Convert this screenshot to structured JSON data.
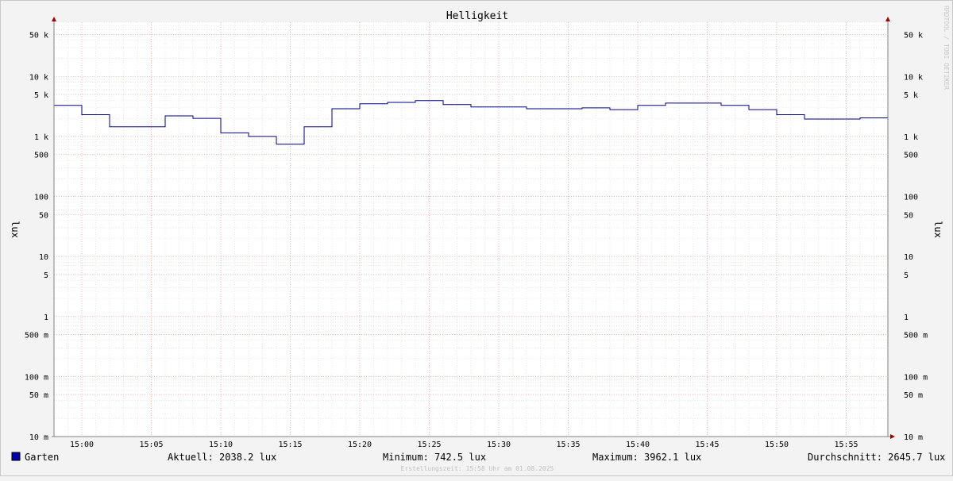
{
  "chart_data": {
    "type": "line",
    "title": "Helligkeit",
    "ylabel": "lux",
    "yscale": "log",
    "ylim": [
      0.01,
      80000
    ],
    "y_ticks": [
      {
        "v": 50000,
        "label": "50 k"
      },
      {
        "v": 10000,
        "label": "10 k"
      },
      {
        "v": 5000,
        "label": "5 k"
      },
      {
        "v": 1000,
        "label": "1 k"
      },
      {
        "v": 500,
        "label": "500"
      },
      {
        "v": 100,
        "label": "100"
      },
      {
        "v": 50,
        "label": "50"
      },
      {
        "v": 10,
        "label": "10"
      },
      {
        "v": 5,
        "label": "5"
      },
      {
        "v": 1,
        "label": "1"
      },
      {
        "v": 0.5,
        "label": "500 m"
      },
      {
        "v": 0.1,
        "label": "100 m"
      },
      {
        "v": 0.05,
        "label": "50 m"
      },
      {
        "v": 0.01,
        "label": "10 m"
      }
    ],
    "xlim": [
      "14:58",
      "15:58"
    ],
    "x_ticks": [
      "15:00",
      "15:05",
      "15:10",
      "15:15",
      "15:20",
      "15:25",
      "15:30",
      "15:35",
      "15:40",
      "15:45",
      "15:50",
      "15:55"
    ],
    "grid": true,
    "series": [
      {
        "name": "Garten",
        "color": "#000080",
        "step": true,
        "x": [
          "14:58",
          "15:00",
          "15:02",
          "15:04",
          "15:06",
          "15:08",
          "15:10",
          "15:12",
          "15:14",
          "15:16",
          "15:18",
          "15:20",
          "15:22",
          "15:24",
          "15:26",
          "15:28",
          "15:30",
          "15:32",
          "15:34",
          "15:36",
          "15:38",
          "15:40",
          "15:42",
          "15:44",
          "15:46",
          "15:48",
          "15:50",
          "15:52",
          "15:54",
          "15:56",
          "15:58"
        ],
        "y": [
          3300,
          2300,
          1450,
          1450,
          2200,
          2000,
          1150,
          1000,
          742.5,
          1450,
          2900,
          3500,
          3700,
          3962.1,
          3400,
          3100,
          3100,
          2900,
          2900,
          3000,
          2800,
          3300,
          3600,
          3600,
          3300,
          2800,
          2300,
          1950,
          1950,
          2038.2,
          2038.2
        ]
      }
    ]
  },
  "legend": {
    "series_name": "Garten",
    "swatch_color": "#0000a8",
    "aktuell": "Aktuell: 2038.2 lux",
    "minimum": "Minimum: 742.5 lux",
    "maximum": "Maximum: 3962.1 lux",
    "durchschnitt": "Durchschnitt: 2645.7 lux"
  },
  "footer": "Erstellungszeit: 15:58 Uhr am 01.08.2025",
  "watermark": "RRDTOOL / TOBI OETIKER",
  "colors": {
    "major_grid": "#f0a0a0",
    "minor_grid": "#d8d8d8",
    "axis": "#808080",
    "arrow": "#a00000"
  }
}
